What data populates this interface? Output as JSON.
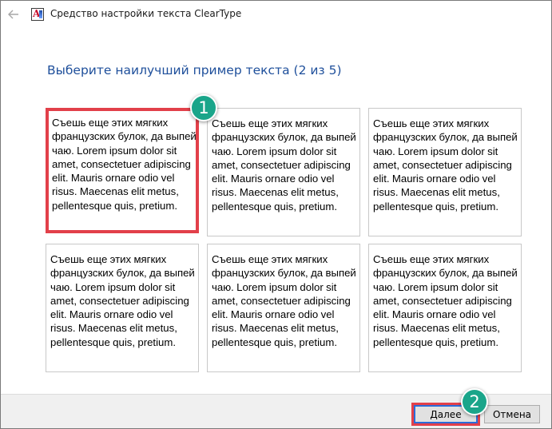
{
  "window": {
    "title": "Средство настройки текста ClearType",
    "back_icon": "arrow-left-icon"
  },
  "page": {
    "heading": "Выберите наилучший пример текста (2 из 5)"
  },
  "samples": [
    "Съешь еще этих мягких французских булок, да выпей чаю. Lorem ipsum dolor sit amet, consectetuer adipiscing elit. Mauris ornare odio vel risus. Maecenas elit metus, pellentesque quis, pretium.",
    "Съешь еще этих мягких французских булок, да выпей чаю. Lorem ipsum dolor sit amet, consectetuer adipiscing elit. Mauris ornare odio vel risus. Maecenas elit metus, pellentesque quis, pretium.",
    "Съешь еще этих мягких французских булок, да выпей чаю. Lorem ipsum dolor sit amet, consectetuer adipiscing elit. Mauris ornare odio vel risus. Maecenas elit metus, pellentesque quis, pretium.",
    "Съешь еще этих мягких французских булок, да выпей чаю. Lorem ipsum dolor sit amet, consectetuer adipiscing elit. Mauris ornare odio vel risus. Maecenas elit metus, pellentesque quis, pretium.",
    "Съешь еще этих мягких французских булок, да выпей чаю. Lorem ipsum dolor sit amet, consectetuer adipiscing elit. Mauris ornare odio vel risus. Maecenas elit metus, pellentesque quis, pretium.",
    "Съешь еще этих мягких французских булок, да выпей чаю. Lorem ipsum dolor sit amet, consectetuer adipiscing elit. Mauris ornare odio vel risus. Maecenas elit metus, pellentesque quis, pretium."
  ],
  "annotations": {
    "badge_1": "1",
    "badge_2": "2"
  },
  "buttons": {
    "next": "Далее",
    "cancel": "Отмена"
  },
  "colors": {
    "heading": "#1e4f9b",
    "highlight": "#e2404a",
    "badge": "#1aa58a",
    "default_button_border": "#2b6cd9"
  }
}
